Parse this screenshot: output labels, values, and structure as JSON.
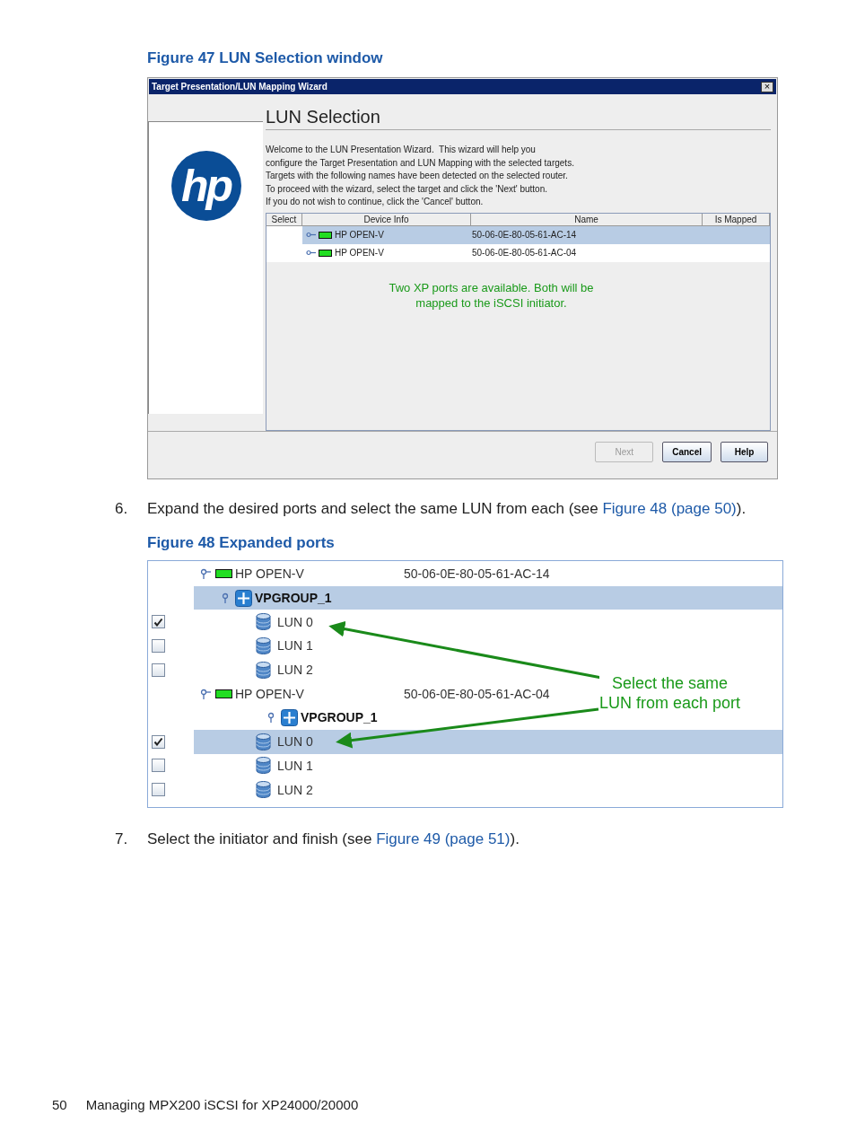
{
  "figure_47": {
    "caption": "Figure 47 LUN Selection window",
    "window": {
      "title": "Target Presentation/LUN Mapping Wizard",
      "close": "×",
      "logo": {
        "text": "hp"
      },
      "heading": "LUN Selection",
      "intro_lines": [
        "Welcome to the LUN Presentation Wizard.  This wizard will help you",
        "configure the Target Presentation and LUN Mapping with the selected targets.",
        "Targets with the following names have been detected on the selected router.",
        "To proceed with the wizard, select the target and click the 'Next' button.",
        "If you do not wish to continue, click the 'Cancel' button."
      ],
      "table": {
        "columns": [
          "Select",
          "Device Info",
          "Name",
          "Is Mapped"
        ],
        "rows": [
          {
            "device": "HP OPEN-V",
            "name": "50-06-0E-80-05-61-AC-14",
            "selected": true
          },
          {
            "device": "HP OPEN-V",
            "name": "50-06-0E-80-05-61-AC-04",
            "selected": false
          }
        ]
      },
      "message_lines": [
        "Two XP ports are available. Both will be",
        "mapped to the iSCSI initiator."
      ],
      "buttons": [
        {
          "label": "Next",
          "disabled": true
        },
        {
          "label": "Cancel",
          "disabled": false
        },
        {
          "label": "Help",
          "disabled": false
        }
      ]
    }
  },
  "step_6": {
    "number": "6.",
    "text_before": "Expand the desired ports and select the same LUN from each (see ",
    "link": "Figure 48 (page 50)",
    "text_after": ")."
  },
  "figure_48": {
    "caption": "Figure 48 Expanded ports",
    "tree": [
      {
        "kind": "port",
        "label": "HP OPEN-V",
        "address": "50-06-0E-80-05-61-AC-14",
        "selected": false,
        "children": [
          {
            "kind": "group",
            "label": "VPGROUP_1",
            "selected": true,
            "children": [
              {
                "kind": "lun",
                "label": "LUN 0",
                "checked": true,
                "selected": false
              },
              {
                "kind": "lun",
                "label": "LUN 1",
                "checked": false,
                "selected": false
              },
              {
                "kind": "lun",
                "label": "LUN 2",
                "checked": false,
                "selected": false
              }
            ]
          }
        ]
      },
      {
        "kind": "port",
        "label": "HP OPEN-V",
        "address": "50-06-0E-80-05-61-AC-04",
        "selected": false,
        "children": [
          {
            "kind": "group",
            "label": "VPGROUP_1",
            "selected": false,
            "children": [
              {
                "kind": "lun",
                "label": "LUN 0",
                "checked": true,
                "selected": true
              },
              {
                "kind": "lun",
                "label": "LUN 1",
                "checked": false,
                "selected": false
              },
              {
                "kind": "lun",
                "label": "LUN 2",
                "checked": false,
                "selected": false
              }
            ]
          }
        ]
      }
    ],
    "callout": {
      "lines": [
        "Select the same",
        "LUN from each port"
      ]
    }
  },
  "step_7": {
    "number": "7.",
    "text_before": "Select the initiator and finish (see ",
    "link": "Figure 49 (page 51)",
    "text_after": ")."
  },
  "footer": {
    "page_number": "50",
    "title": "Managing MPX200 iSCSI for XP24000/20000"
  }
}
